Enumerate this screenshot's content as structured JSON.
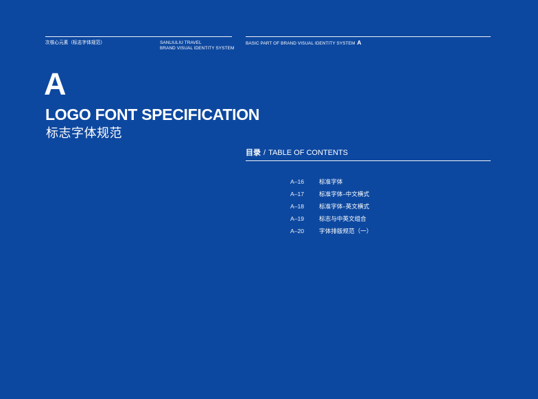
{
  "header": {
    "cn_label": "次核心元素（标志字体规范）",
    "brand_line1": "SANLIULIU TRAVEL",
    "brand_line2": "BRAND VISUAL IDENTITY SYSTEM",
    "section_label": "BASIC PART OF BRAND VISUAL IDENTITY SYSTEM",
    "section_letter": "A"
  },
  "main": {
    "letter": "A",
    "title_en": "LOGO FONT SPECIFICATION",
    "title_cn": "标志字体规范"
  },
  "toc": {
    "label_cn": "目录",
    "separator": "/",
    "label_en": "TABLE OF CONTENTS",
    "items": [
      {
        "code": "A–16",
        "title": "标准字体"
      },
      {
        "code": "A–17",
        "title": "标准字体–中文横式"
      },
      {
        "code": "A–18",
        "title": "标准字体–英文横式"
      },
      {
        "code": "A–19",
        "title": "标志与中英文组合"
      },
      {
        "code": "A–20",
        "title": "字体排版规范（一）"
      }
    ]
  },
  "colors": {
    "background": "#0d48a0",
    "foreground": "#ffffff"
  }
}
